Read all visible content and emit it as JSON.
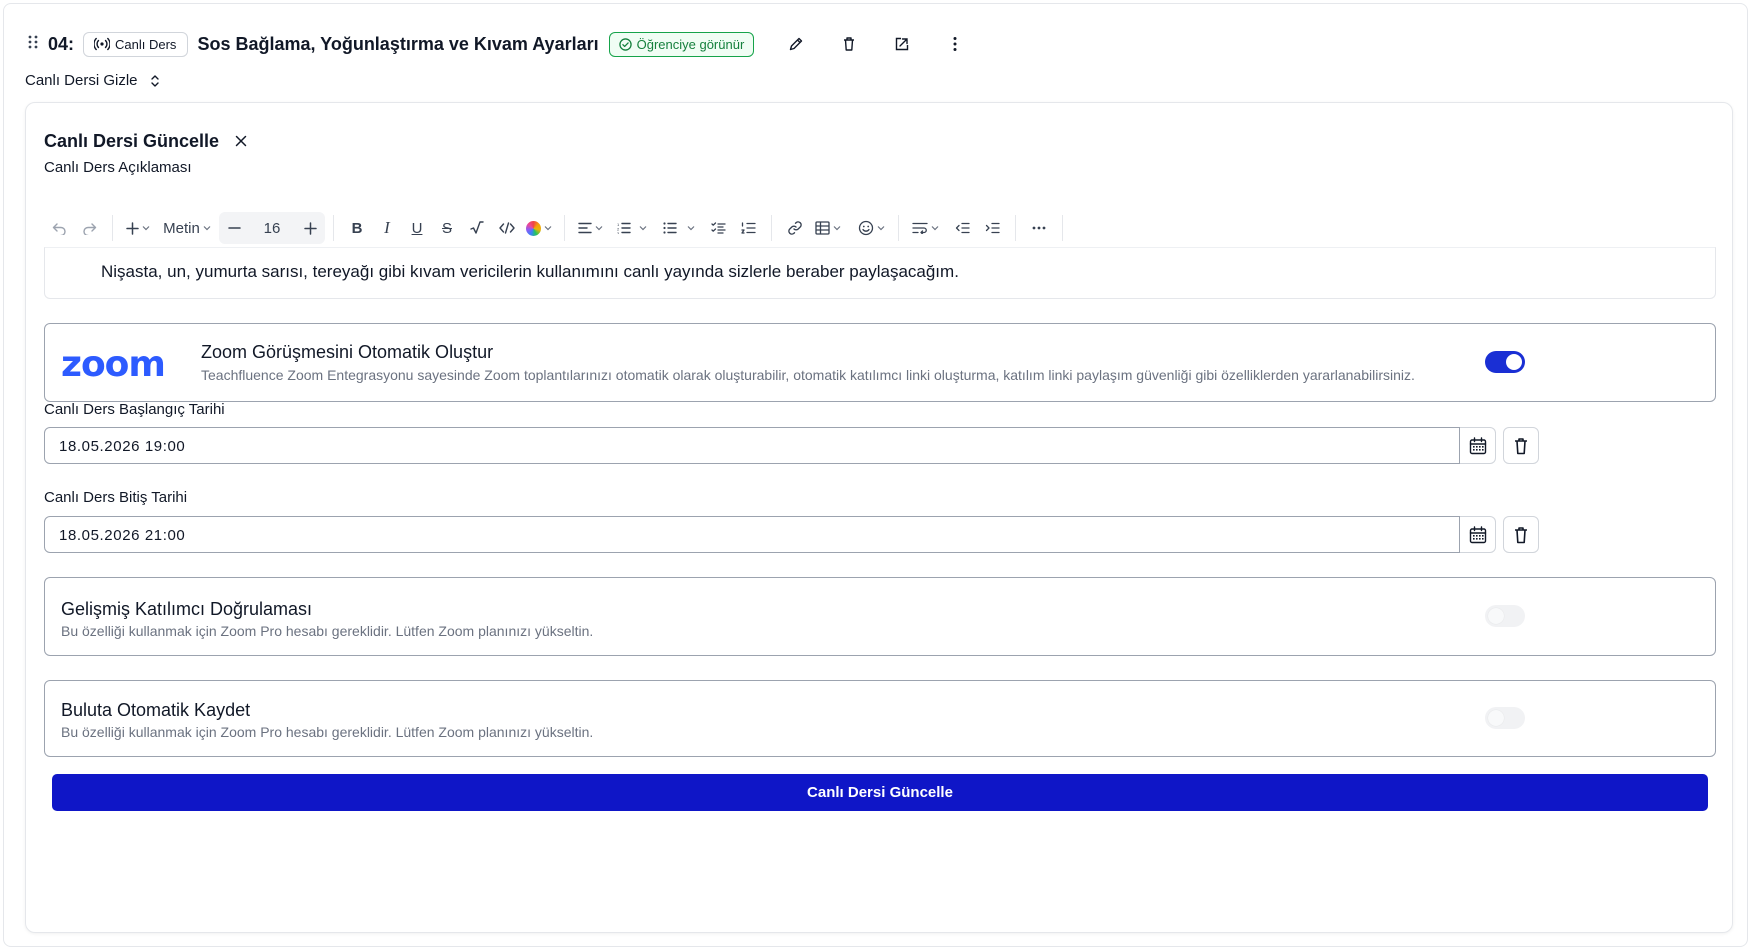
{
  "lesson": {
    "number": "04:",
    "type_label": "Canlı Ders",
    "title": "Sos Bağlama, Yoğunlaştırma ve Kıvam Ayarları",
    "visibility_badge": "Öğrenciye görünür",
    "hide_toggle_label": "Canlı Dersi Gizle"
  },
  "form": {
    "title": "Canlı Dersi Güncelle",
    "description_label": "Canlı Ders Açıklaması",
    "editor": {
      "text_style": "Metin",
      "font_size": "16",
      "content": "Nişasta, un, yumurta sarısı, tereyağı gibi kıvam vericilerin kullanımını canlı yayında sizlerle beraber paylaşacağım."
    },
    "zoom": {
      "logo_text": "zoom",
      "title": "Zoom Görüşmesini Otomatik Oluştur",
      "description": "Teachfluence Zoom Entegrasyonu sayesinde Zoom toplantılarınızı otomatik olarak oluşturabilir, otomatik katılımcı linki oluşturma, katılım linki paylaşım güvenliği gibi özelliklerden yararlanabilirsiniz.",
      "enabled": true
    },
    "start_label": "Canlı Ders Başlangıç Tarihi",
    "start_value": "18.05.2026 19:00",
    "end_label": "Canlı Ders Bitiş Tarihi",
    "end_value": "18.05.2026 21:00",
    "options": [
      {
        "title": "Gelişmiş Katılımcı Doğrulaması",
        "description": "Bu özelliği kullanmak için Zoom Pro hesabı gereklidir. Lütfen Zoom planınızı yükseltin.",
        "enabled": false
      },
      {
        "title": "Buluta Otomatik Kaydet",
        "description": "Bu özelliği kullanmak için Zoom Pro hesabı gereklidir. Lütfen Zoom planınızı yükseltin.",
        "enabled": false
      }
    ],
    "submit_label": "Canlı Dersi Güncelle"
  },
  "colors": {
    "primary": "#0f16c7",
    "toggle_on": "#1a2fd4",
    "success": "#15803d",
    "zoom_brand": "#2d5bff"
  }
}
